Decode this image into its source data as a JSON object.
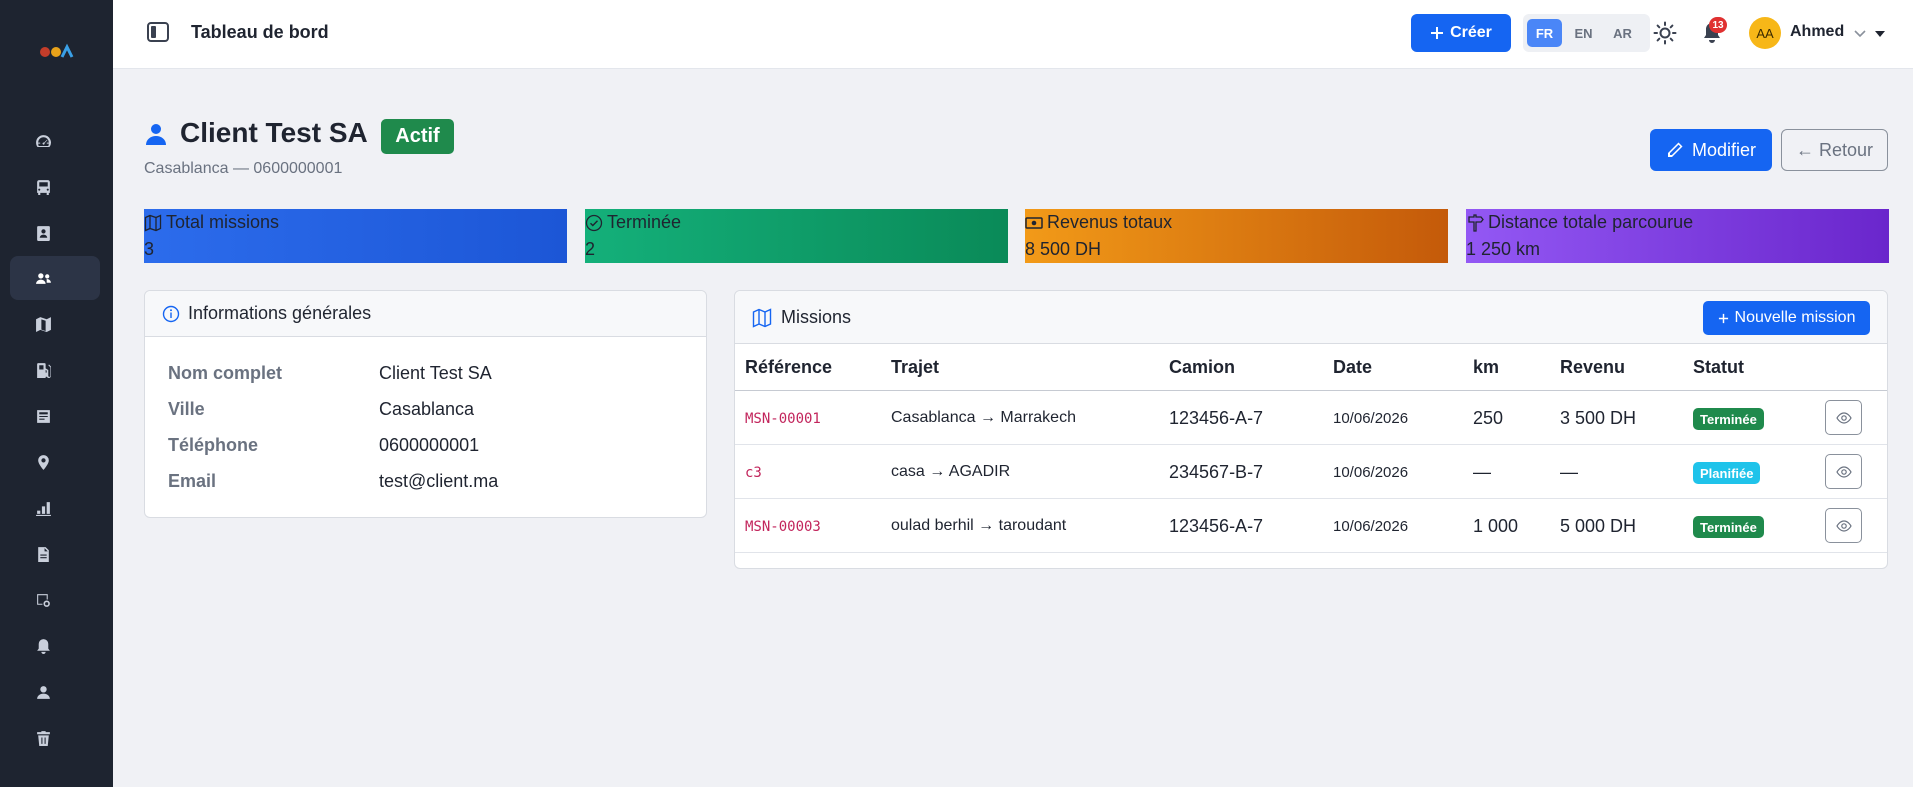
{
  "header": {
    "title": "Tableau de bord",
    "create_label": "Créer",
    "languages": [
      "FR",
      "EN",
      "AR"
    ],
    "active_language": "FR",
    "notification_count": "13",
    "user_initials": "AA",
    "user_name": "Ahmed"
  },
  "sidebar": {
    "items": [
      {
        "icon": "dashboard-icon",
        "active": false
      },
      {
        "icon": "bus-icon",
        "active": false
      },
      {
        "icon": "contact-card-icon",
        "active": false
      },
      {
        "icon": "users-icon",
        "active": true
      },
      {
        "icon": "map-icon",
        "active": false
      },
      {
        "icon": "fuel-icon",
        "active": false
      },
      {
        "icon": "receipt-icon",
        "active": false
      },
      {
        "icon": "location-pin-icon",
        "active": false
      },
      {
        "icon": "bar-chart-icon",
        "active": false
      },
      {
        "icon": "document-icon",
        "active": false
      },
      {
        "icon": "settings-icon",
        "active": false
      },
      {
        "icon": "bell-icon",
        "active": false
      },
      {
        "icon": "user-icon",
        "active": false
      },
      {
        "icon": "trash-icon",
        "active": false
      }
    ]
  },
  "client": {
    "name": "Client Test SA",
    "status": "Actif",
    "subtitle": "Casablanca — 0600000001",
    "edit_label": "Modifier",
    "back_label": "← Retour"
  },
  "stats": [
    {
      "label": "Total missions",
      "value": "3",
      "icon": "map-icon"
    },
    {
      "label": "Terminée",
      "value": "2",
      "icon": "check-circle-icon"
    },
    {
      "label": "Revenus totaux",
      "value": "8 500 DH",
      "icon": "cash-icon"
    },
    {
      "label": "Distance totale parcourue",
      "value": "1 250 km",
      "icon": "signpost-icon"
    }
  ],
  "info": {
    "title": "Informations générales",
    "rows": [
      {
        "key": "Nom complet",
        "value": "Client Test SA"
      },
      {
        "key": "Ville",
        "value": "Casablanca"
      },
      {
        "key": "Téléphone",
        "value": "0600000001"
      },
      {
        "key": "Email",
        "value": "test@client.ma"
      }
    ]
  },
  "missions": {
    "title": "Missions",
    "new_label": "Nouvelle mission",
    "columns": [
      "Référence",
      "Trajet",
      "Camion",
      "Date",
      "km",
      "Revenu",
      "Statut"
    ],
    "rows": [
      {
        "ref": "MSN-00001",
        "trajet": "Casablanca → Marrakech",
        "camion": "123456-A-7",
        "date": "10/06/2026",
        "km": "250",
        "revenu": "3 500 DH",
        "statut": "Terminée",
        "status_color": "#1f8a4c"
      },
      {
        "ref": "c3",
        "trajet": "casa → AGADIR",
        "camion": "234567-B-7",
        "date": "10/06/2026",
        "km": "—",
        "revenu": "—",
        "statut": "Planifiée",
        "status_color": "#1fc3ea"
      },
      {
        "ref": "MSN-00003",
        "trajet": "oulad berhil → taroudant",
        "camion": "123456-A-7",
        "date": "10/06/2026",
        "km": "1 000",
        "revenu": "5 000 DH",
        "statut": "Terminée",
        "status_color": "#1f8a4c"
      }
    ]
  }
}
